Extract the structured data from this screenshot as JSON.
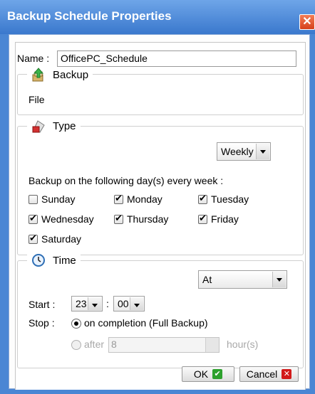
{
  "window": {
    "title": "Backup Schedule Properties"
  },
  "name_field": {
    "label": "Name :",
    "value": "OfficePC_Schedule"
  },
  "backup_section": {
    "legend": "Backup",
    "value": "File"
  },
  "type_section": {
    "legend": "Type",
    "frequency": "Weekly",
    "instruction": "Backup on the following day(s) every week :",
    "days": [
      {
        "label": "Sunday",
        "checked": false
      },
      {
        "label": "Monday",
        "checked": true
      },
      {
        "label": "Tuesday",
        "checked": true
      },
      {
        "label": "Wednesday",
        "checked": true
      },
      {
        "label": "Thursday",
        "checked": true
      },
      {
        "label": "Friday",
        "checked": true
      },
      {
        "label": "Saturday",
        "checked": true
      }
    ]
  },
  "time_section": {
    "legend": "Time",
    "mode": "At",
    "start_label": "Start :",
    "start_hour": "23",
    "separator": ":",
    "start_minute": "00",
    "stop_label": "Stop :",
    "stop_option_completion": "on completion (Full Backup)",
    "stop_option_after": "after",
    "after_value": "8",
    "after_unit": "hour(s)"
  },
  "buttons": {
    "ok": "OK",
    "cancel": "Cancel"
  }
}
